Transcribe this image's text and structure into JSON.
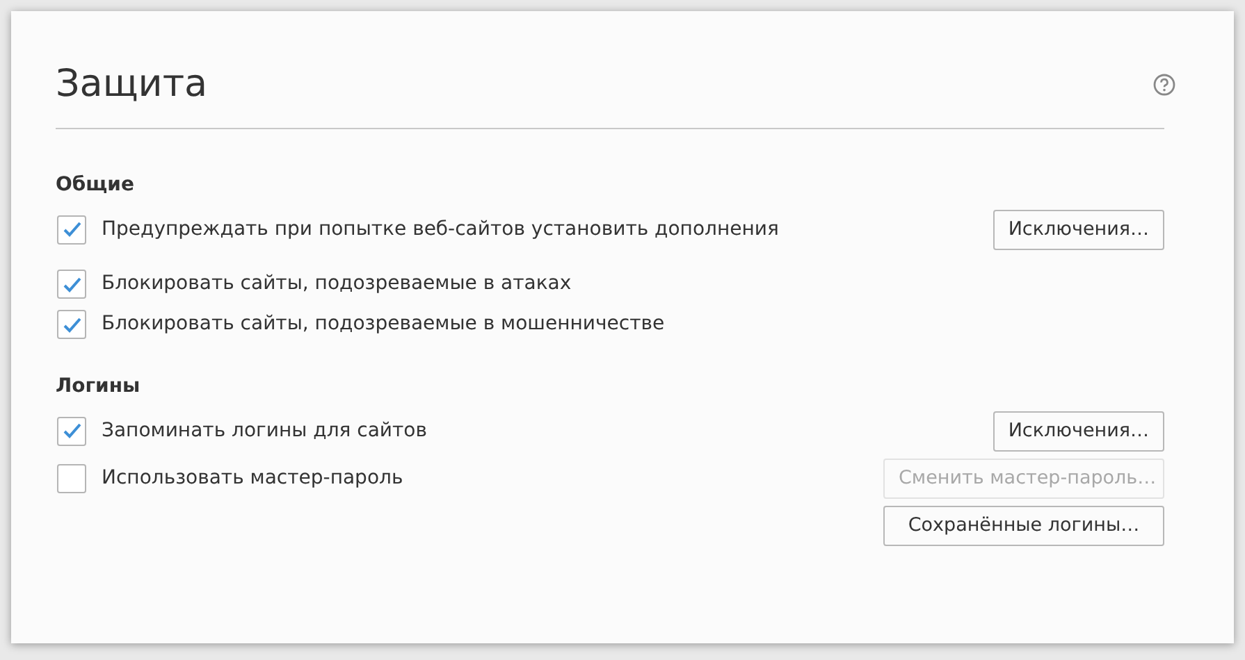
{
  "title": "Защита",
  "sections": [
    {
      "title": "Общие",
      "rows": [
        {
          "kind": "checkbox",
          "label": "Предупреждать при попытке веб-сайтов установить дополнения",
          "checked": true,
          "button": {
            "label": "Исключения…",
            "disabled": false
          }
        },
        {
          "kind": "checkbox",
          "label": "Блокировать сайты, подозреваемые в атаках",
          "checked": true
        },
        {
          "kind": "checkbox",
          "label": "Блокировать сайты, подозреваемые в мошенничестве",
          "checked": true
        }
      ]
    },
    {
      "title": "Логины",
      "rows": [
        {
          "kind": "checkbox",
          "label": "Запоминать логины для сайтов",
          "checked": true,
          "button": {
            "label": "Исключения…",
            "disabled": false
          }
        },
        {
          "kind": "checkbox",
          "label": "Использовать мастер-пароль",
          "checked": false,
          "button": {
            "label": "Сменить мастер-пароль…",
            "disabled": true
          }
        },
        {
          "kind": "button",
          "button": {
            "label": "Сохранённые логины…",
            "disabled": false
          }
        }
      ]
    }
  ]
}
